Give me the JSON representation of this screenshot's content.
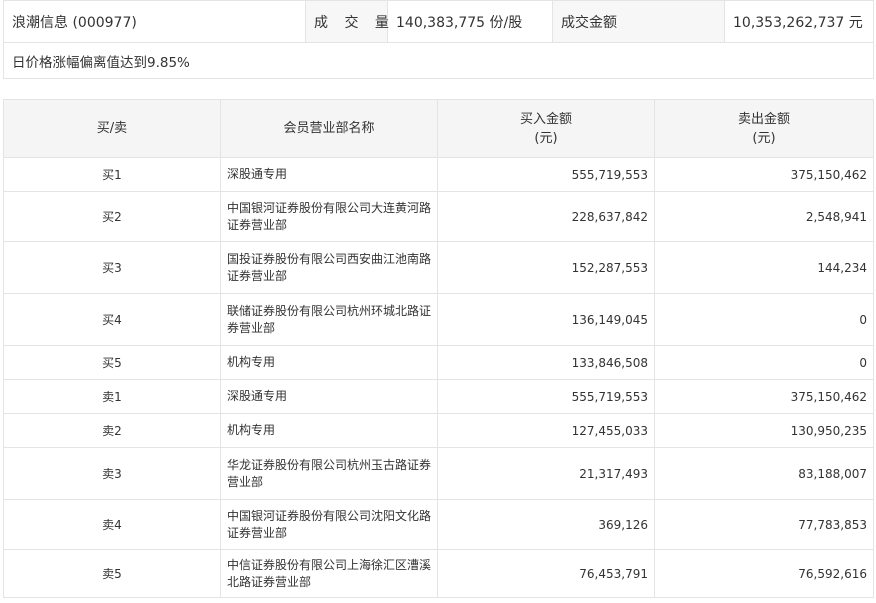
{
  "summary": {
    "stock": "浪潮信息 (000977)",
    "volume_label": "成 交 量",
    "volume_value": "140,383,775 份/股",
    "amount_label": "成交金额",
    "amount_value": "10,353,262,737 元",
    "reason": "日价格涨幅偏离值达到9.85%"
  },
  "table": {
    "headers": {
      "side": "买/卖",
      "dept": "会员营业部名称",
      "buy_line1": "买入金额",
      "buy_line2": "(元)",
      "sell_line1": "卖出金额",
      "sell_line2": "(元)"
    },
    "rows": [
      {
        "side": "买1",
        "name": "深股通专用",
        "buy": "555,719,553",
        "sell": "375,150,462"
      },
      {
        "side": "买2",
        "name": "中国银河证券股份有限公司大连黄河路证券营业部",
        "buy": "228,637,842",
        "sell": "2,548,941"
      },
      {
        "side": "买3",
        "name": "国投证券股份有限公司西安曲江池南路证券营业部",
        "buy": "152,287,553",
        "sell": "144,234"
      },
      {
        "side": "买4",
        "name": "联储证券股份有限公司杭州环城北路证券营业部",
        "buy": "136,149,045",
        "sell": "0"
      },
      {
        "side": "买5",
        "name": "机构专用",
        "buy": "133,846,508",
        "sell": "0"
      },
      {
        "side": "卖1",
        "name": "深股通专用",
        "buy": "555,719,553",
        "sell": "375,150,462"
      },
      {
        "side": "卖2",
        "name": "机构专用",
        "buy": "127,455,033",
        "sell": "130,950,235"
      },
      {
        "side": "卖3",
        "name": "华龙证券股份有限公司杭州玉古路证券营业部",
        "buy": "21,317,493",
        "sell": "83,188,007"
      },
      {
        "side": "卖4",
        "name": "中国银河证券股份有限公司沈阳文化路证券营业部",
        "buy": "369,126",
        "sell": "77,783,853"
      },
      {
        "side": "卖5",
        "name": "中信证券股份有限公司上海徐汇区漕溪北路证券营业部",
        "buy": "76,453,791",
        "sell": "76,592,616"
      }
    ]
  }
}
